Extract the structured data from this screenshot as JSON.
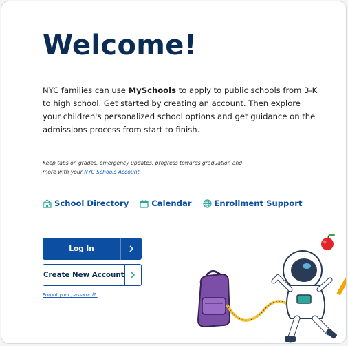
{
  "welcome": {
    "title": "Welcome!",
    "intro_before": "NYC families can use ",
    "brand": "MySchools",
    "intro_after": " to apply to public schools from 3-K to high school. Get started by creating an account. Then explore your children's personalized school options and get guidance on the admissions process from start to finish.",
    "note_text": "Keep tabs on grades, emergency updates, progress towards graduation and more with your ",
    "note_link": "NYC Schools Account",
    "note_end": "."
  },
  "quick_links": [
    {
      "label": "School Directory",
      "icon": "school-icon"
    },
    {
      "label": "Calendar",
      "icon": "calendar-icon"
    },
    {
      "label": "Enrollment Support",
      "icon": "globe-icon"
    }
  ],
  "auth": {
    "login_label": "Log In",
    "create_label": "Create New Account",
    "forgot_label": "Forgot your password?."
  },
  "colors": {
    "title": "#0b2d55",
    "primary": "#0b4ea2",
    "link": "#1b5fbe",
    "accent_green": "#2ba89a",
    "backpack": "#7b4ea8"
  },
  "illustration": {
    "icons": [
      "astronaut-icon",
      "backpack-icon",
      "apple-icon",
      "tape-measure-icon"
    ]
  }
}
